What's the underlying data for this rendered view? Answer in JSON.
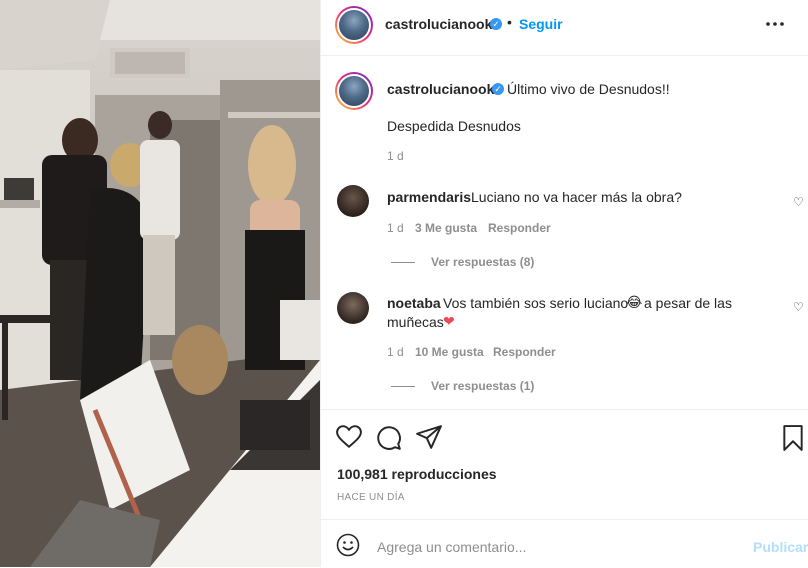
{
  "header": {
    "username": "castrolucianook",
    "dot": "•",
    "follow_label": "Seguir",
    "more_icon": "ellipsis-icon"
  },
  "caption": {
    "username": "castrolucianook",
    "text": "Último vivo de Desnudos!!",
    "line2": "Despedida Desnudos",
    "time": "1 d"
  },
  "comments": [
    {
      "username": "parmendaris",
      "text": "Luciano no va hacer más la obra?",
      "time": "1 d",
      "likes": "3 Me gusta",
      "reply": "Responder",
      "view_replies": "Ver respuestas (8)"
    },
    {
      "username": "noetaba",
      "text": "Vos también sos serio luciano",
      "emoji1": "😂",
      "text2": " a pesar de las",
      "text3": "muñecas",
      "emoji2": "❤",
      "time": "1 d",
      "likes": "10 Me gusta",
      "reply": "Responder",
      "view_replies": "Ver respuestas (1)"
    }
  ],
  "actions": {
    "views": "100,981 reproducciones",
    "timestamp": "HACE UN DÍA",
    "icons": [
      "heart-icon",
      "comment-icon",
      "share-icon",
      "bookmark-icon"
    ]
  },
  "add_comment": {
    "placeholder": "Agrega un comentario...",
    "post_label": "Publicar",
    "emoji_icon": "smiley-icon"
  },
  "colors": {
    "accent": "#0095f6",
    "verified": "#3897f0",
    "muted": "#8e8e8e",
    "text": "#262626"
  }
}
